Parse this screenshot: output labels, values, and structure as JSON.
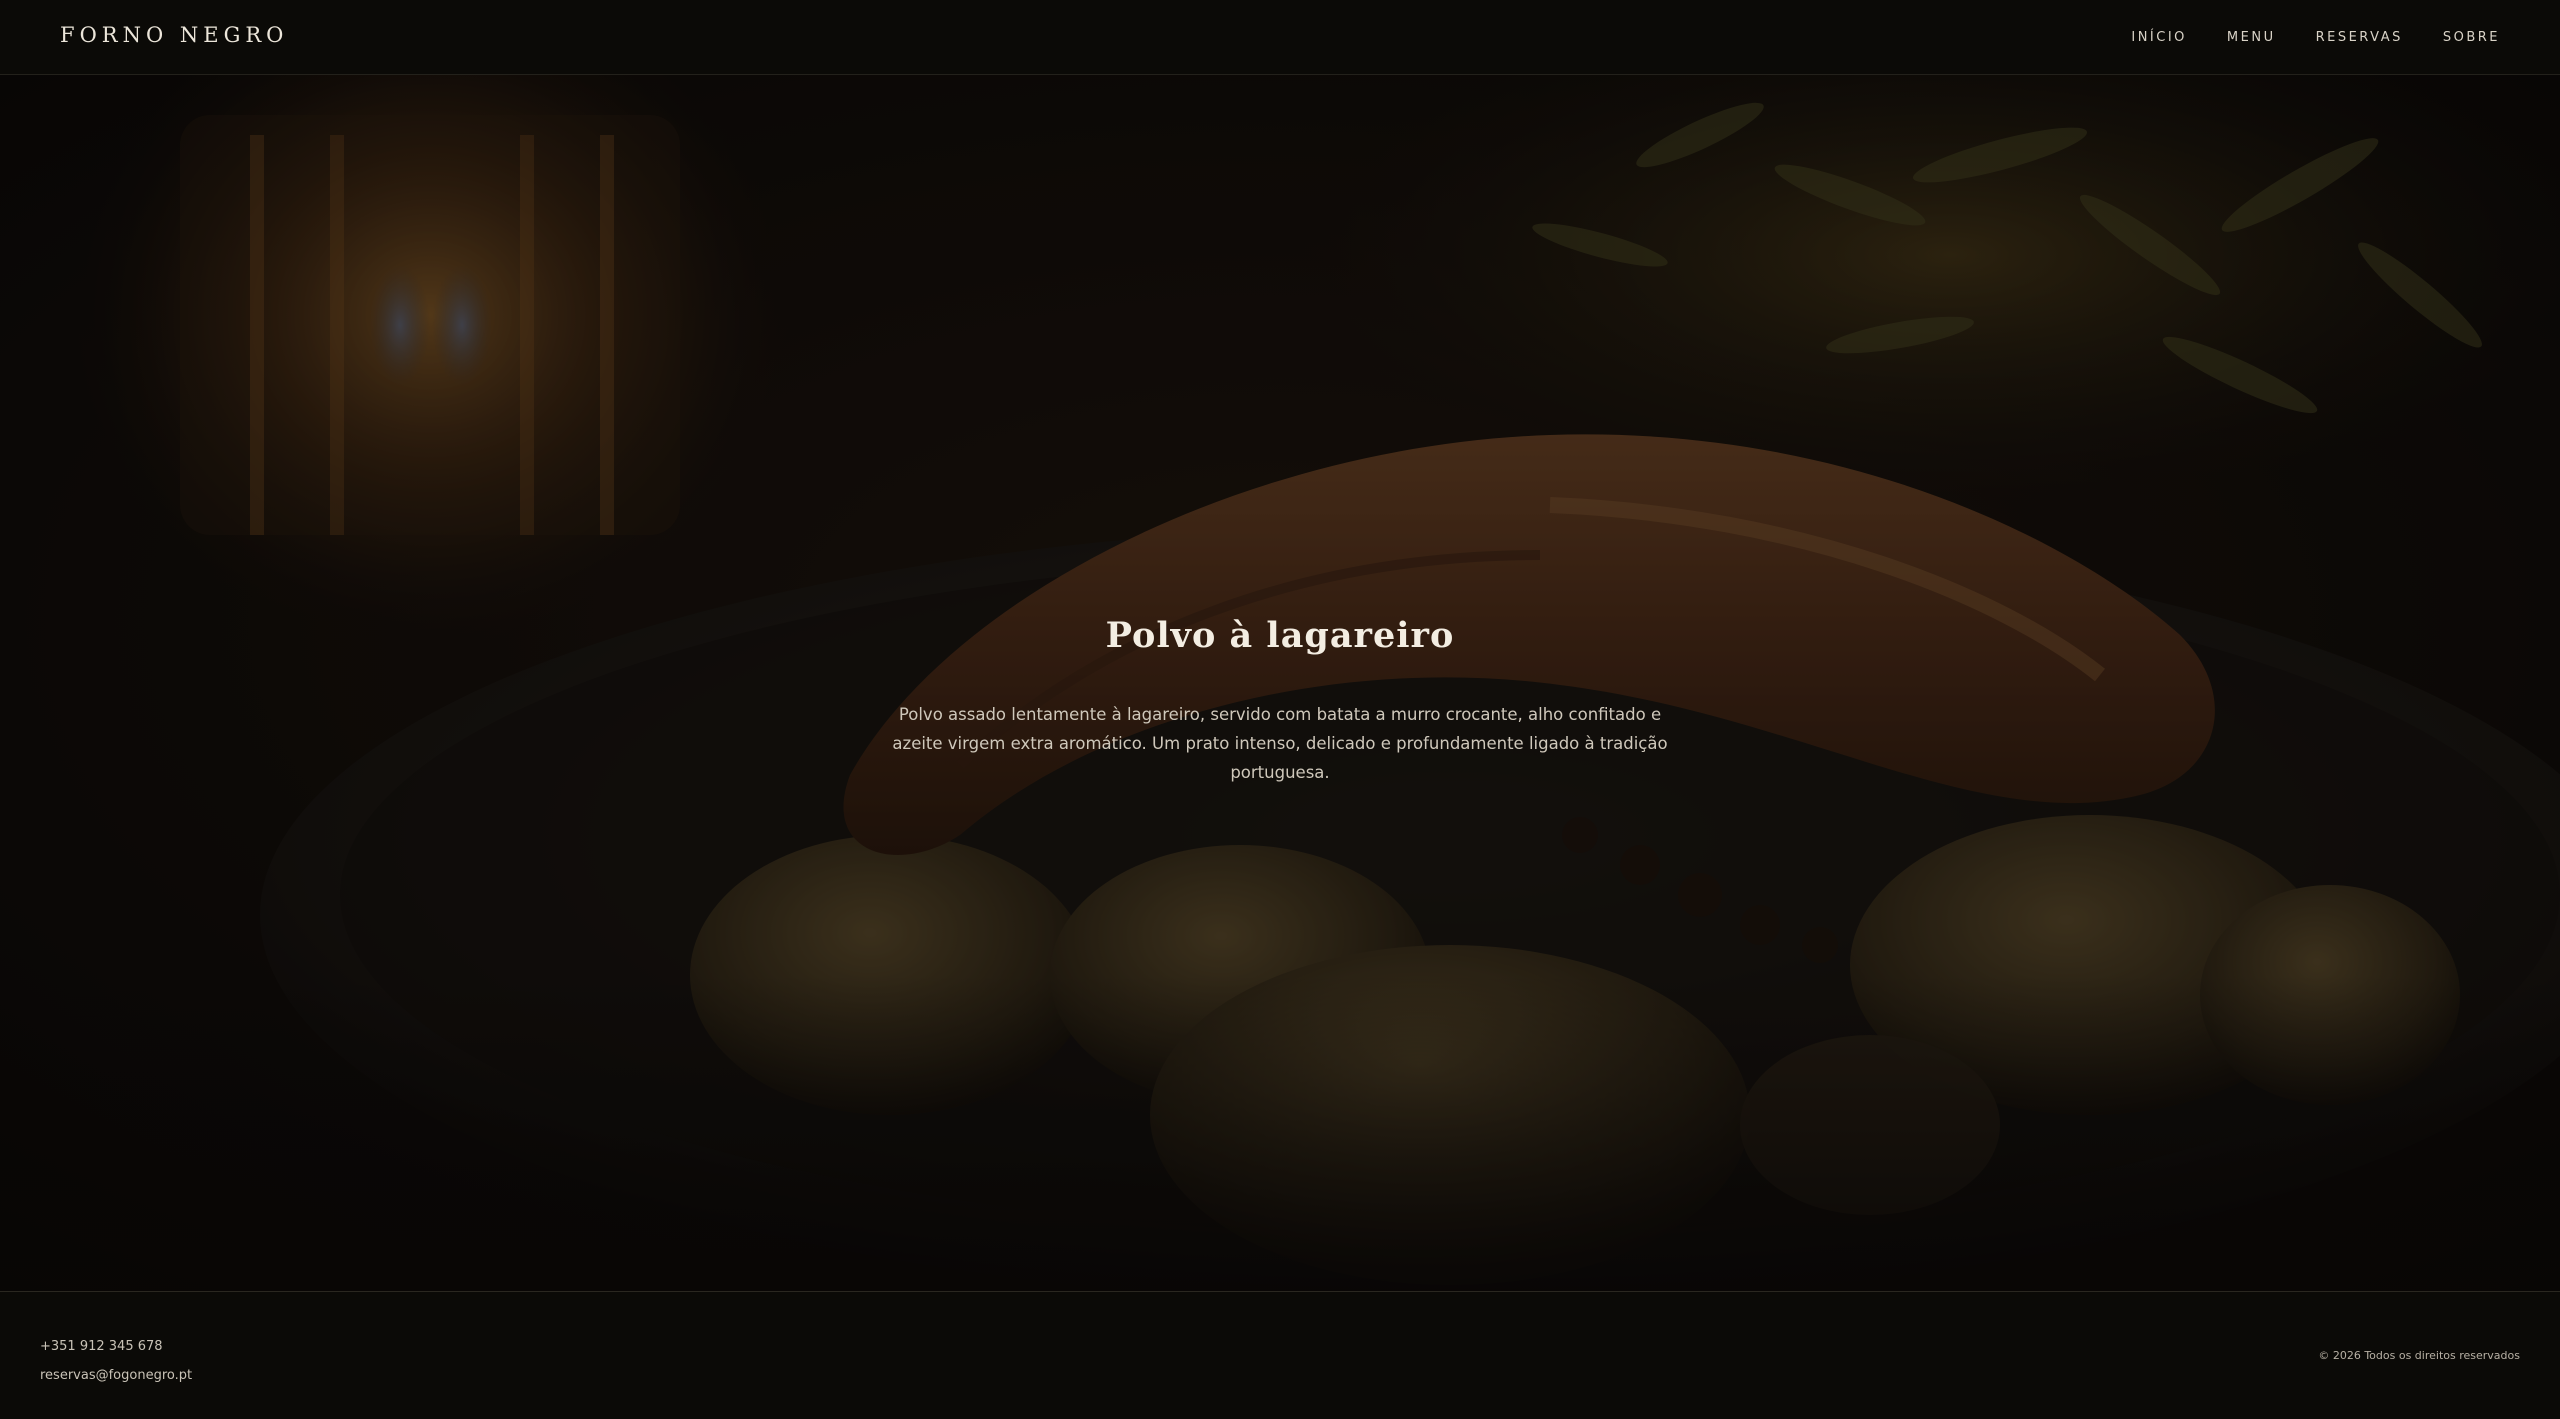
{
  "header": {
    "brand": "FORNO NEGRO",
    "nav": [
      {
        "label": "INÍCIO"
      },
      {
        "label": "MENU"
      },
      {
        "label": "RESERVAS"
      },
      {
        "label": "SOBRE"
      }
    ]
  },
  "hero": {
    "title": "Polvo à lagareiro",
    "description": "Polvo assado lentamente à lagareiro, servido com batata a murro crocante, alho confitado e azeite virgem extra aromático. Um prato intenso, delicado e profundamente ligado à tradição portuguesa."
  },
  "footer": {
    "phone": "+351 912 345 678",
    "email": "reservas@fogonegro.pt",
    "copyright": "© 2026 Todos os direitos reservados"
  },
  "colors": {
    "background": "#0b0a07",
    "text_light": "#ece6da",
    "accent_warm": "#c88a3c"
  }
}
